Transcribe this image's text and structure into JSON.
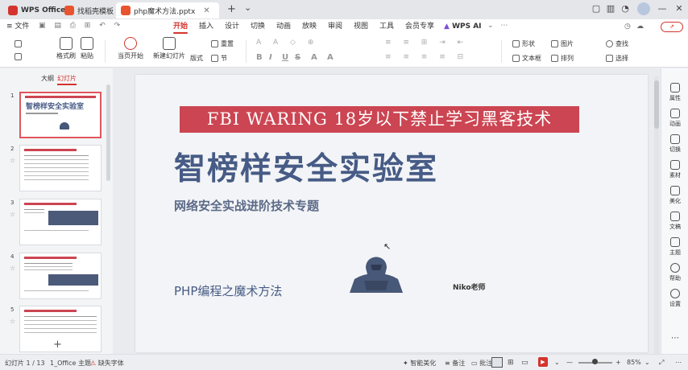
{
  "titlebar": {
    "tabs": [
      {
        "label": "WPS Office",
        "icon": "wps-logo-icon"
      },
      {
        "label": "找稻壳模板",
        "icon": "docer-icon"
      },
      {
        "label": "php魔术方法.pptx",
        "icon": "ppt-file-icon",
        "active": true
      }
    ],
    "new_tab": "+",
    "dropdown": "⌄"
  },
  "menubar": {
    "file": "文件",
    "items": [
      "开始",
      "插入",
      "设计",
      "切换",
      "动画",
      "放映",
      "审阅",
      "视图",
      "工具",
      "会员专享"
    ],
    "active": "开始",
    "ai": "WPS AI"
  },
  "ribbon": {
    "format_painter": "格式刷",
    "paste": "粘贴",
    "play_from_current": "当页开始",
    "new_slide": "新建幻灯片",
    "layout": "版式",
    "section": "节",
    "reset": "重置",
    "shape": "形状",
    "picture": "图片",
    "textbox": "文本框",
    "arrange": "排列",
    "find": "查找",
    "select": "选择",
    "format_glyphs": [
      "B",
      "I",
      "U",
      "S",
      "A",
      "A"
    ]
  },
  "panel": {
    "tab_outline": "大纲",
    "tab_slides": "幻灯片",
    "slide_numbers": [
      "1",
      "2",
      "3",
      "4",
      "5"
    ],
    "thumb1_title": "智榜样安全实验室",
    "add": "+"
  },
  "slide": {
    "banner": "FBI WARING 18岁以下禁止学习黑客技术",
    "title": "智榜样安全实验室",
    "subtitle": "网络安全实战进阶技术专题",
    "course": "PHP编程之魔术方法",
    "teacher": "Niko老师"
  },
  "rightbar": [
    "属性",
    "动画",
    "切换",
    "素材",
    "美化",
    "文稿",
    "主题",
    "帮助",
    "设置"
  ],
  "status": {
    "slide_counter": "幻灯片 1 / 13",
    "theme": "1_Office 主题",
    "missing_font": "缺失字体",
    "smart_beautify": "智能美化",
    "notes": "备注",
    "comments": "批注",
    "zoom": "85%"
  },
  "colors": {
    "accent": "#d4342d",
    "banner": "#cc4552",
    "title": "#465b85",
    "hacker": "#475878"
  }
}
